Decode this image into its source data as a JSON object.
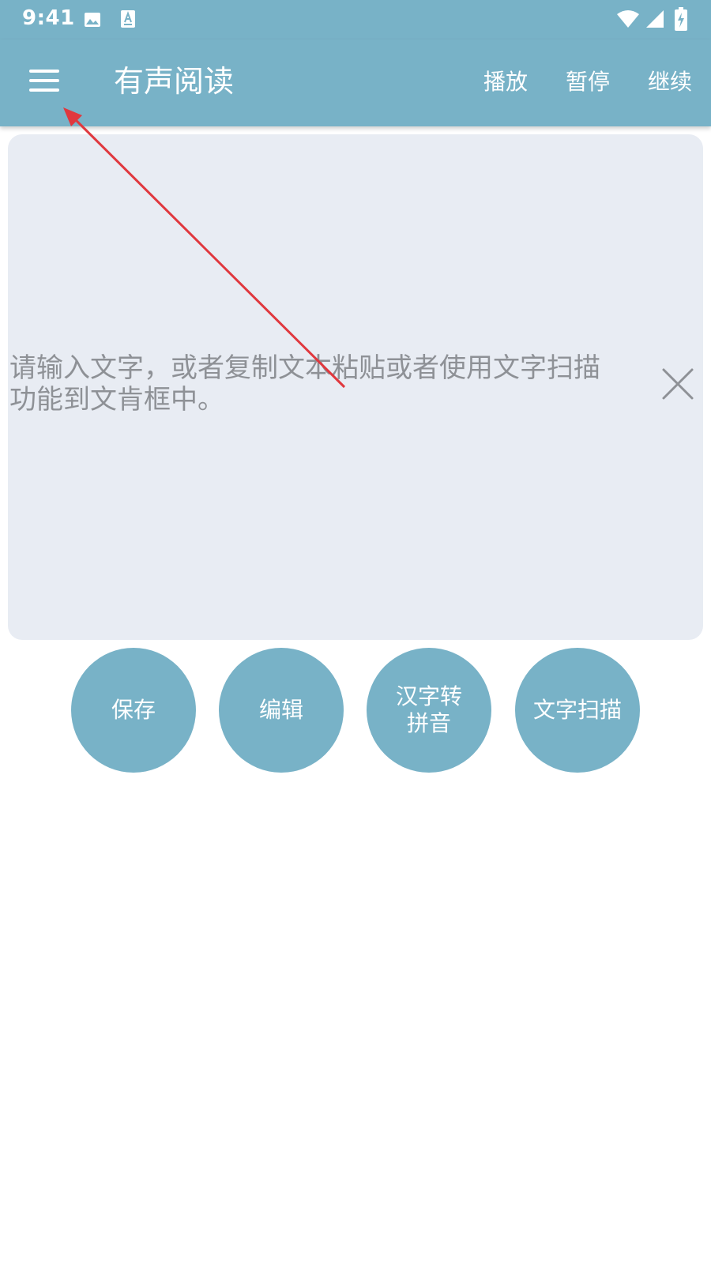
{
  "status_bar": {
    "time": "9:41",
    "icons": [
      "image-icon",
      "a-badge-icon",
      "wifi-icon",
      "signal-icon",
      "battery-icon"
    ]
  },
  "app_bar": {
    "menu_icon": "hamburger-menu-icon",
    "title": "有声阅读",
    "actions": {
      "play": "播放",
      "pause": "暂停",
      "resume": "继续"
    }
  },
  "text_area": {
    "placeholder_line1": "请输入文字，或者复制文本粘贴或者使用文字扫描",
    "placeholder_line2": "功能到文肯框中。",
    "clear_icon": "close-icon"
  },
  "buttons": {
    "save": "保存",
    "edit": "编辑",
    "pinyin_line1": "汉字转",
    "pinyin_line2": "拼音",
    "scan": "文字扫描"
  },
  "colors": {
    "accent": "#78b2c7",
    "text_area_bg": "#e8ecf3",
    "placeholder": "#8e9196",
    "annotation": "#e0383e"
  }
}
